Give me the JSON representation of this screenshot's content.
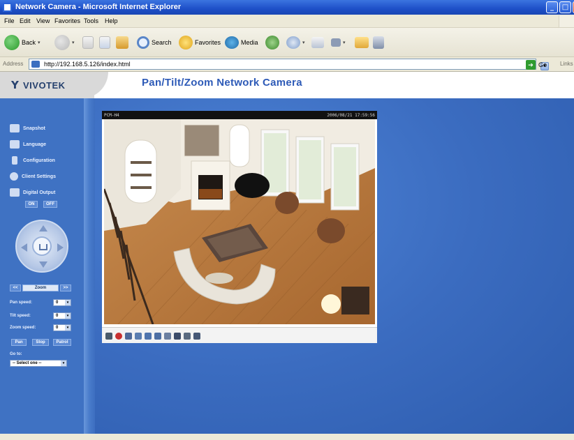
{
  "window": {
    "title": "Network Camera - Microsoft Internet Explorer",
    "minimize_glyph": "_",
    "maximize_glyph": "□",
    "close_glyph": "×"
  },
  "menu": {
    "items": [
      "File",
      "Edit",
      "View",
      "Favorites",
      "Tools",
      "Help"
    ]
  },
  "toolbar": {
    "back_label": "Back",
    "search_label": "Search",
    "favorites_label": "Favorites",
    "media_label": "Media",
    "dropdown_glyph": "▾",
    "icons": [
      "back-icon",
      "forward-icon",
      "stop-icon",
      "refresh-icon",
      "home-icon",
      "search-icon",
      "favorites-icon",
      "media-icon",
      "history-icon",
      "mail-icon",
      "print-icon",
      "edit-icon",
      "folder-icon",
      "messenger-icon"
    ]
  },
  "address": {
    "label": "Address",
    "url": "http://192.168.5.126/index.html",
    "dropdown_glyph": "▾",
    "go_label": "Go",
    "go_glyph": "➔",
    "links_label": "Links"
  },
  "page": {
    "title": "Pan/Tilt/Zoom Network Camera",
    "logo_text": "VIVOTEK",
    "logo_mark": "Y",
    "colors": {
      "background": "#3d6ec0",
      "title": "#2d5ab7",
      "sidebar": "#3f72c3"
    }
  },
  "sidebar": {
    "menu": [
      {
        "label": "Snapshot",
        "icon": "camera-icon"
      },
      {
        "label": "Language",
        "icon": "globe-icon"
      },
      {
        "label": "Configuration",
        "icon": "wrench-icon"
      },
      {
        "label": "Client Settings",
        "icon": "client-settings-icon"
      },
      {
        "label": "Digital Output",
        "icon": "output-icon"
      }
    ],
    "digital_output_on": "ON",
    "digital_output_off": "OFF",
    "zoom_label": "Zoom",
    "zoom_minus": "<<",
    "zoom_plus": ">>",
    "pan_speed_label": "Pan speed:",
    "pan_speed_value": "0",
    "tilt_speed_label": "Tilt speed:",
    "tilt_speed_value": "0",
    "zoom_speed_label": "Zoom speed:",
    "zoom_speed_value": "0",
    "pan_button": "Pan",
    "stop_button": "Stop",
    "patrol_button": "Patrol",
    "goto_label": "Go to:",
    "goto_select": "-- Select one --",
    "select_arrow_glyph": "▾"
  },
  "video": {
    "status_left": "PCM-H4",
    "status_right": "2006/08/21 17:59:56",
    "controls": [
      "snapshot-ctrl-icon",
      "record-ctrl-icon",
      "digital-zoom-ctrl-icon",
      "stop-ctrl-icon",
      "play-ctrl-icon",
      "pause-ctrl-icon",
      "volume-ctrl-icon",
      "mute-ctrl-icon",
      "talk-ctrl-icon",
      "fullscreen-ctrl-icon"
    ]
  }
}
